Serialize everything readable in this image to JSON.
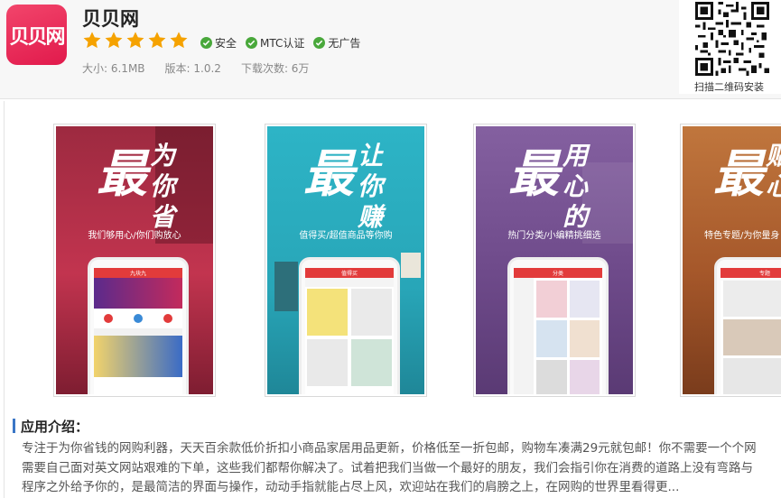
{
  "app": {
    "name": "贝贝网",
    "icon_text": "贝贝网",
    "rating_stars": 5,
    "badges": [
      "安全",
      "MTC认证",
      "无广告"
    ],
    "size": "大小: 6.1MB",
    "version": "版本: 1.0.2",
    "downloads": "下载次数: 6万"
  },
  "qr": {
    "label": "扫描二维码安装"
  },
  "screenshots": [
    {
      "big": "最",
      "side": "为你省",
      "subtitle": "我们够用心/你们购放心",
      "top_label": "九块九",
      "bg": "#b8304d"
    },
    {
      "big": "最",
      "side": "让你赚",
      "subtitle": "值得买/超值商品等你购",
      "top_label": "值得买",
      "bg": "#2aaec0"
    },
    {
      "big": "最",
      "side": "用心的",
      "subtitle": "热门分类/小编精挑细选",
      "top_label": "分类",
      "bg": "#7a4f93"
    },
    {
      "big": "最",
      "side": "贴心",
      "subtitle": "特色专题/为你量身",
      "top_label": "专题",
      "bg": "#b6622e"
    }
  ],
  "intro": {
    "title": "应用介绍：",
    "lines": [
      "专注于为你省钱的网购利器，天天百余款低价折扣小商品家居用品更新，价格低至一折包邮，购物车凑满29元就包邮！你不需要一个个网",
      "需要自己面对英文网站艰难的下单，这些我们都帮你解决了。试着把我们当做一个最好的朋友，我们会指引你在消费的道路上没有弯路与",
      "程序之外给予你的，是最简洁的界面与操作，动动手指就能占尽上风，欢迎站在我们的肩膀之上，在网购的世界里看得更..."
    ]
  },
  "colors": {
    "brand": "#e8234f",
    "star": "#f5a200",
    "check": "#49a83b",
    "accent": "#3a76c6"
  }
}
